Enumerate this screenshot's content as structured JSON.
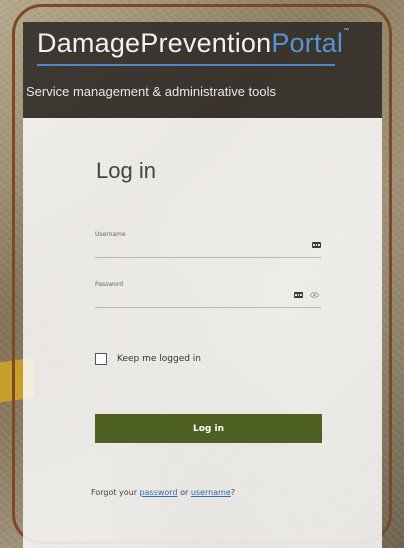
{
  "header": {
    "brand_main": "DamagePrevention",
    "brand_accent": "Portal",
    "brand_mark": "™",
    "tagline": "Service management & administrative tools"
  },
  "form": {
    "title": "Log in",
    "username_label": "Username",
    "username_value": "",
    "password_label": "Password",
    "password_value": "",
    "keep_logged_in_label": "Keep me logged in",
    "keep_logged_in_checked": false,
    "login_button_label": "Log in",
    "forgot_prefix": "Forgot your ",
    "forgot_password_link": "password",
    "forgot_middle": " or ",
    "forgot_username_link": "username",
    "forgot_suffix": "?"
  },
  "colors": {
    "header_bg": "#2d2a26",
    "brand_accent": "#5a93d3",
    "login_button": "#4d6021",
    "link": "#2f6bb5",
    "frame_border": "#7a4a26"
  },
  "icons": {
    "username_field_icon": "dots-icon",
    "password_field_icon": "dots-icon",
    "password_reveal_icon": "eye-icon"
  }
}
